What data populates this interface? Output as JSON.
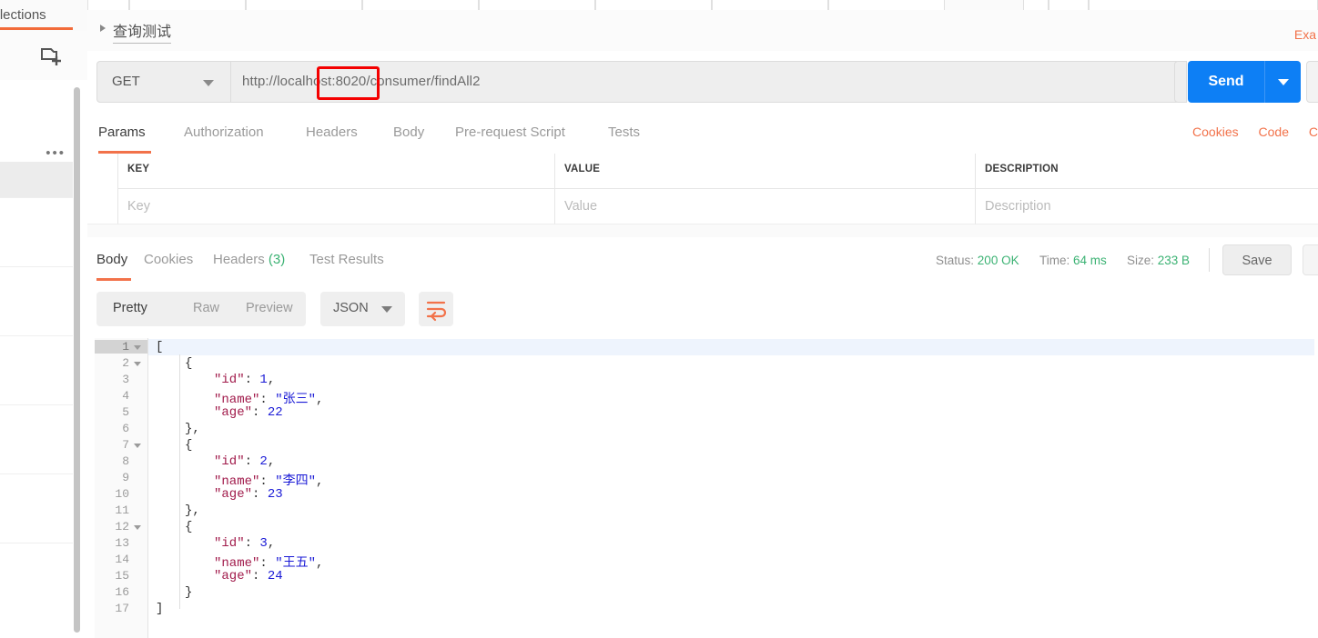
{
  "sidebar": {
    "tab_label": "Collections",
    "new_collection_icon": "new-collection-icon",
    "more_icon": "ellipsis-icon"
  },
  "request": {
    "collection_title": "查询测试",
    "examples_link": "Exa",
    "method": "GET",
    "url": "http://localhost:8020/consumer/findAll2",
    "send_label": "Send",
    "highlight_color": "#f40000",
    "send_color": "#0d7ff5",
    "accent_color": "#f2724a"
  },
  "request_tabs": [
    {
      "label": "Params",
      "active": true
    },
    {
      "label": "Authorization",
      "active": false
    },
    {
      "label": "Headers",
      "active": false
    },
    {
      "label": "Body",
      "active": false
    },
    {
      "label": "Pre-request Script",
      "active": false
    },
    {
      "label": "Tests",
      "active": false
    }
  ],
  "right_links": [
    {
      "label": "Cookies"
    },
    {
      "label": "Code"
    },
    {
      "label": "C"
    }
  ],
  "params_table": {
    "headers": [
      "KEY",
      "VALUE",
      "DESCRIPTION"
    ],
    "placeholder_row": [
      "Key",
      "Value",
      "Description"
    ],
    "bulk_edit_icon": "ellipsis-icon"
  },
  "response_tabs": [
    {
      "label": "Body",
      "count": "",
      "active": true
    },
    {
      "label": "Cookies",
      "count": "",
      "active": false
    },
    {
      "label": "Headers",
      "count": "(3)",
      "active": false
    },
    {
      "label": "Test Results",
      "count": "",
      "active": false
    }
  ],
  "response_meta": {
    "status_label": "Status:",
    "status_value": "200 OK",
    "time_label": "Time:",
    "time_value": "64 ms",
    "size_label": "Size:",
    "size_value": "233 B",
    "save_label": "Save",
    "status_color": "#3bb273"
  },
  "format_bar": {
    "segments": [
      {
        "label": "Pretty",
        "active": true
      },
      {
        "label": "Raw",
        "active": false
      },
      {
        "label": "Preview",
        "active": false
      }
    ],
    "language": "JSON",
    "wrap_icon": "word-wrap-icon"
  },
  "response_body": {
    "language": "json",
    "total_lines": 17,
    "lines": [
      {
        "n": 1,
        "fold": true,
        "indent": 0,
        "tokens": [
          {
            "t": "[",
            "c": "p"
          }
        ]
      },
      {
        "n": 2,
        "fold": true,
        "indent": 1,
        "tokens": [
          {
            "t": "{",
            "c": "p"
          }
        ]
      },
      {
        "n": 3,
        "fold": false,
        "indent": 2,
        "tokens": [
          {
            "t": "\"id\"",
            "c": "k"
          },
          {
            "t": ": ",
            "c": "p"
          },
          {
            "t": "1",
            "c": "v"
          },
          {
            "t": ",",
            "c": "p"
          }
        ]
      },
      {
        "n": 4,
        "fold": false,
        "indent": 2,
        "tokens": [
          {
            "t": "\"name\"",
            "c": "k"
          },
          {
            "t": ": ",
            "c": "p"
          },
          {
            "t": "\"张三\"",
            "c": "v"
          },
          {
            "t": ",",
            "c": "p"
          }
        ]
      },
      {
        "n": 5,
        "fold": false,
        "indent": 2,
        "tokens": [
          {
            "t": "\"age\"",
            "c": "k"
          },
          {
            "t": ": ",
            "c": "p"
          },
          {
            "t": "22",
            "c": "v"
          }
        ]
      },
      {
        "n": 6,
        "fold": false,
        "indent": 1,
        "tokens": [
          {
            "t": "},",
            "c": "p"
          }
        ]
      },
      {
        "n": 7,
        "fold": true,
        "indent": 1,
        "tokens": [
          {
            "t": "{",
            "c": "p"
          }
        ]
      },
      {
        "n": 8,
        "fold": false,
        "indent": 2,
        "tokens": [
          {
            "t": "\"id\"",
            "c": "k"
          },
          {
            "t": ": ",
            "c": "p"
          },
          {
            "t": "2",
            "c": "v"
          },
          {
            "t": ",",
            "c": "p"
          }
        ]
      },
      {
        "n": 9,
        "fold": false,
        "indent": 2,
        "tokens": [
          {
            "t": "\"name\"",
            "c": "k"
          },
          {
            "t": ": ",
            "c": "p"
          },
          {
            "t": "\"李四\"",
            "c": "v"
          },
          {
            "t": ",",
            "c": "p"
          }
        ]
      },
      {
        "n": 10,
        "fold": false,
        "indent": 2,
        "tokens": [
          {
            "t": "\"age\"",
            "c": "k"
          },
          {
            "t": ": ",
            "c": "p"
          },
          {
            "t": "23",
            "c": "v"
          }
        ]
      },
      {
        "n": 11,
        "fold": false,
        "indent": 1,
        "tokens": [
          {
            "t": "},",
            "c": "p"
          }
        ]
      },
      {
        "n": 12,
        "fold": true,
        "indent": 1,
        "tokens": [
          {
            "t": "{",
            "c": "p"
          }
        ]
      },
      {
        "n": 13,
        "fold": false,
        "indent": 2,
        "tokens": [
          {
            "t": "\"id\"",
            "c": "k"
          },
          {
            "t": ": ",
            "c": "p"
          },
          {
            "t": "3",
            "c": "v"
          },
          {
            "t": ",",
            "c": "p"
          }
        ]
      },
      {
        "n": 14,
        "fold": false,
        "indent": 2,
        "tokens": [
          {
            "t": "\"name\"",
            "c": "k"
          },
          {
            "t": ": ",
            "c": "p"
          },
          {
            "t": "\"王五\"",
            "c": "v"
          },
          {
            "t": ",",
            "c": "p"
          }
        ]
      },
      {
        "n": 15,
        "fold": false,
        "indent": 2,
        "tokens": [
          {
            "t": "\"age\"",
            "c": "k"
          },
          {
            "t": ": ",
            "c": "p"
          },
          {
            "t": "24",
            "c": "v"
          }
        ]
      },
      {
        "n": 16,
        "fold": false,
        "indent": 1,
        "tokens": [
          {
            "t": "}",
            "c": "p"
          }
        ]
      },
      {
        "n": 17,
        "fold": false,
        "indent": 0,
        "tokens": [
          {
            "t": "]",
            "c": "p"
          }
        ]
      }
    ]
  }
}
